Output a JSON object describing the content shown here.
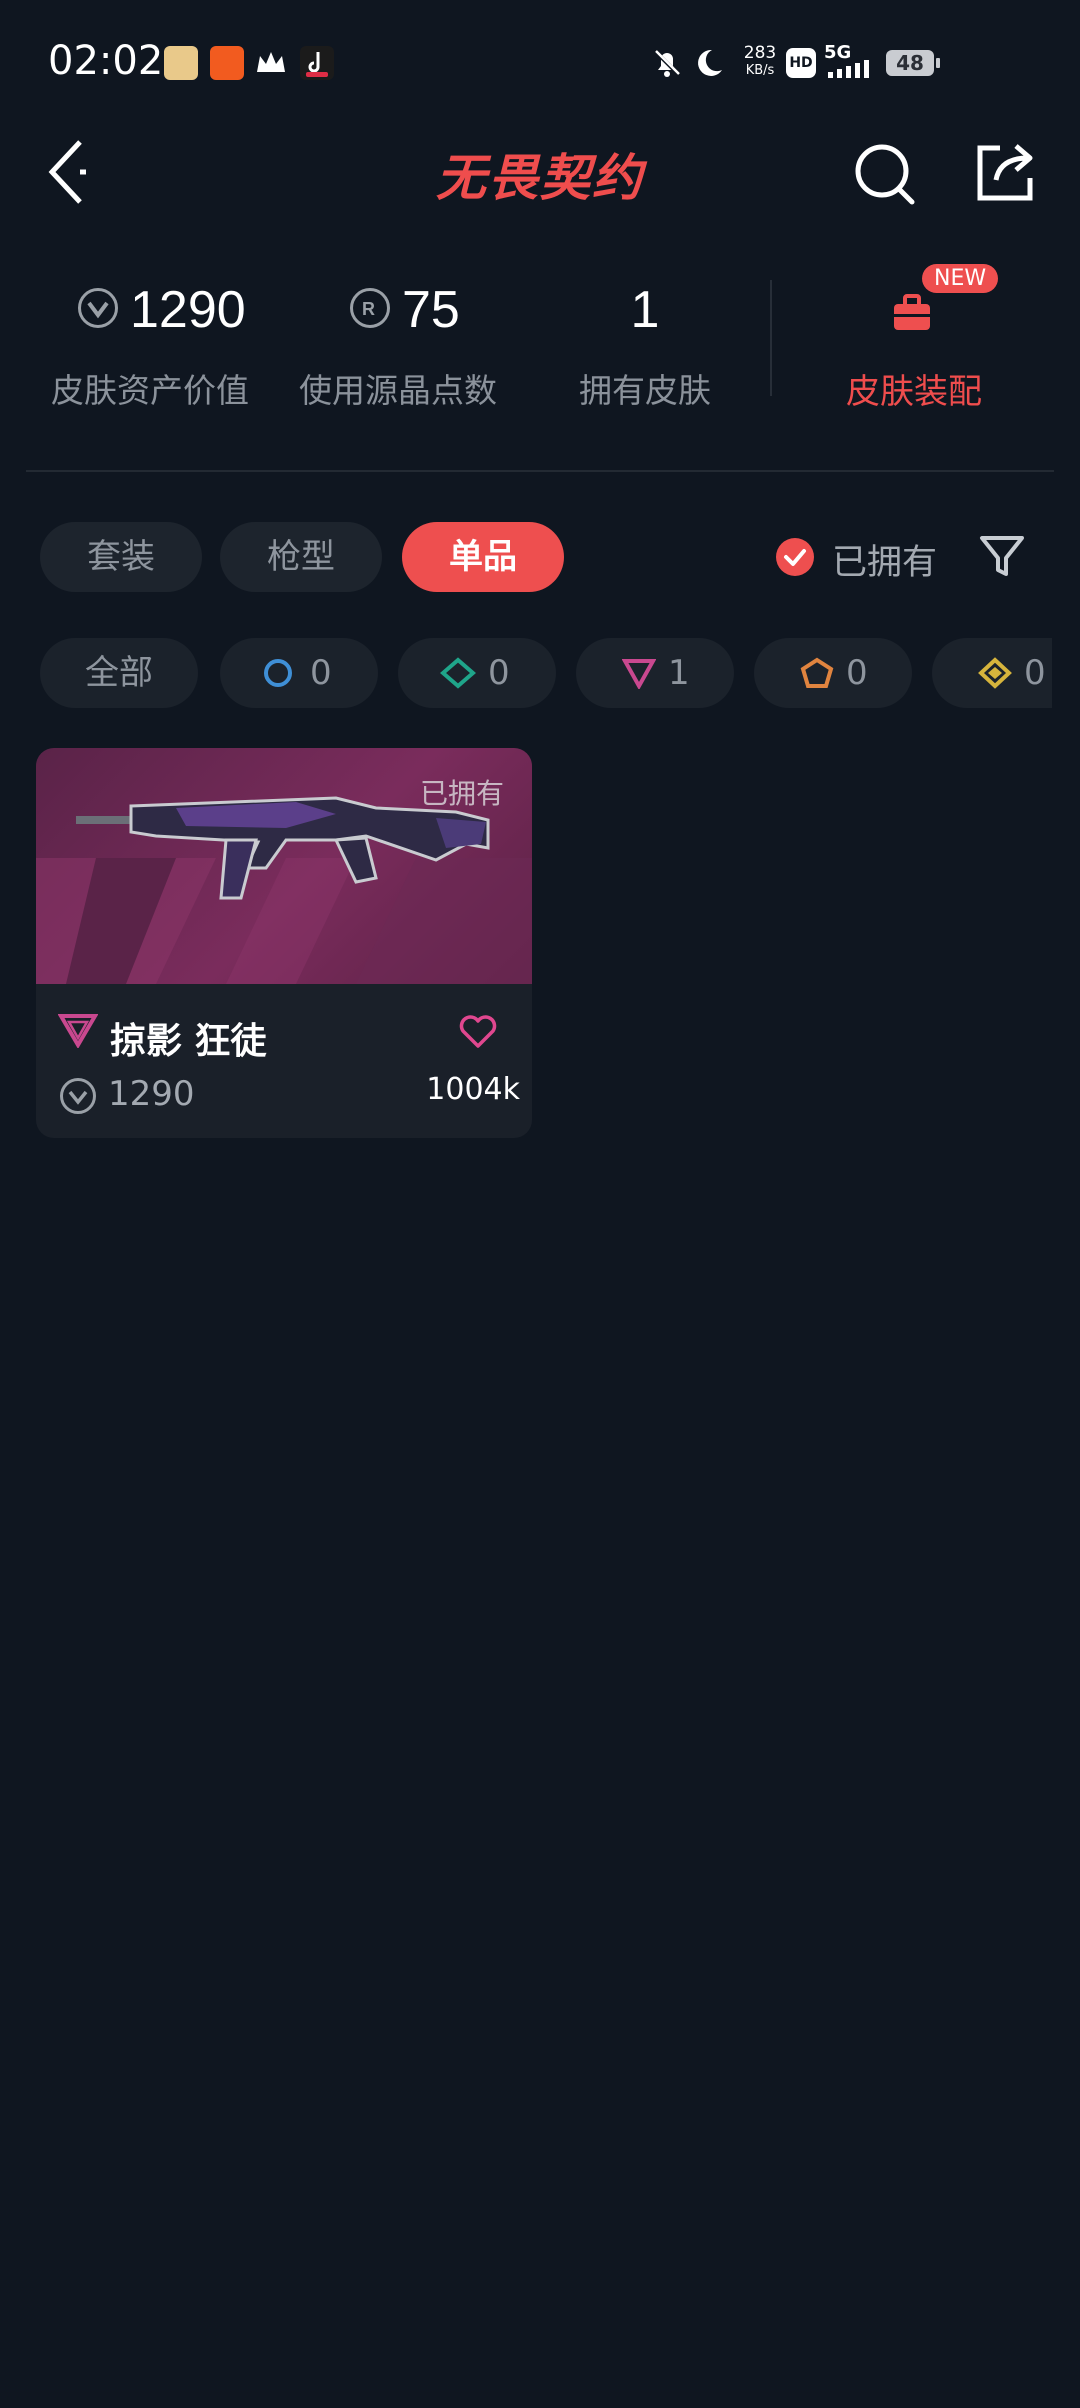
{
  "status_bar": {
    "time": "02:02",
    "net_speed": "283",
    "net_unit": "KB/s",
    "hd": "HD",
    "network": "5G",
    "battery": "48"
  },
  "header": {
    "logo_text": "无畏契约",
    "back_icon": "chevron-left-icon",
    "search_icon": "search-icon",
    "share_icon": "share-icon"
  },
  "stats": [
    {
      "value": "1290",
      "label": "皮肤资产价值",
      "icon": "vp-coin-icon"
    },
    {
      "value": "75",
      "label": "使用源晶点数",
      "icon": "radianite-icon"
    },
    {
      "value": "1",
      "label": "拥有皮肤"
    }
  ],
  "equip": {
    "badge": "NEW",
    "label": "皮肤装配",
    "icon": "briefcase-icon"
  },
  "tabs": [
    {
      "label": "套装",
      "active": false
    },
    {
      "label": "枪型",
      "active": false
    },
    {
      "label": "单品",
      "active": true
    }
  ],
  "owned_filter": {
    "label": "已拥有",
    "checked": true,
    "filter_icon": "funnel-icon"
  },
  "rarity_chips": [
    {
      "label": "全部"
    },
    {
      "count": "0",
      "icon": "select-tier-icon",
      "color": "#3f8fd6"
    },
    {
      "count": "0",
      "icon": "deluxe-tier-icon",
      "color": "#1fa58a"
    },
    {
      "count": "1",
      "icon": "premium-tier-icon",
      "color": "#c9488f"
    },
    {
      "count": "0",
      "icon": "exclusive-tier-icon",
      "color": "#e0843f"
    },
    {
      "count": "0",
      "icon": "ultra-tier-icon",
      "color": "#d6b43c"
    }
  ],
  "items": [
    {
      "name": "掠影 狂徒",
      "owned_tag": "已拥有",
      "price": "1290",
      "likes": "1004k",
      "tier_color": "#c9488f"
    }
  ],
  "colors": {
    "accent": "#ee4f4f",
    "background": "#0f1620"
  }
}
